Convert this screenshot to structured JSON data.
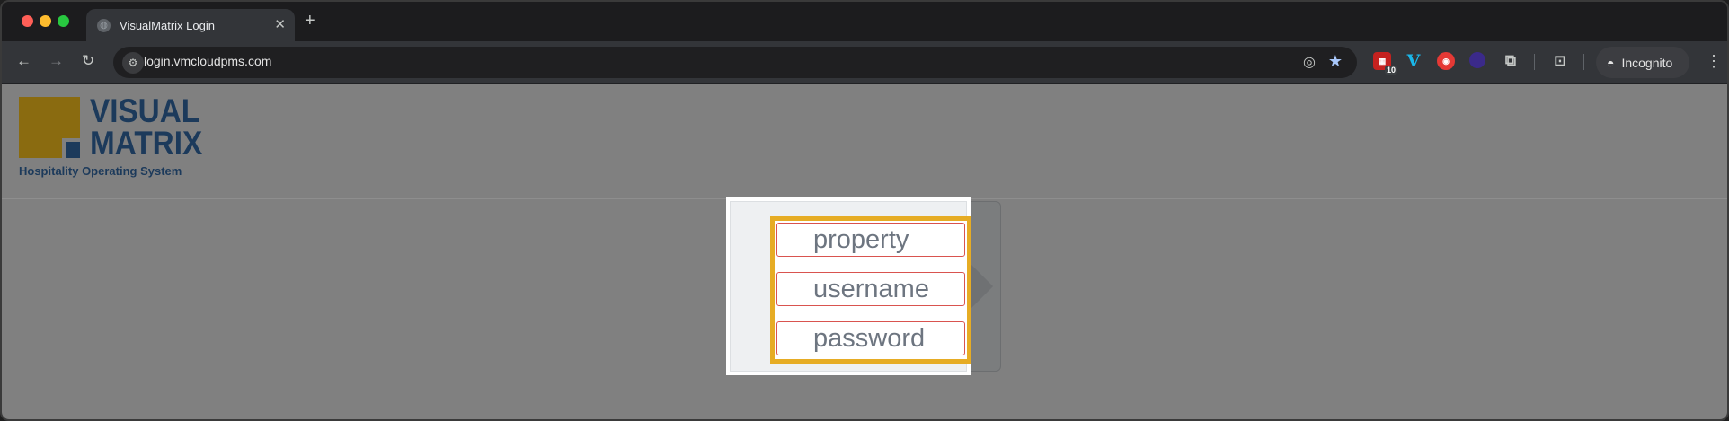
{
  "browser": {
    "tab": {
      "title": "VisualMatrix Login",
      "close_glyph": "✕",
      "newtab_glyph": "+"
    },
    "nav": {
      "back_glyph": "←",
      "forward_glyph": "→",
      "reload_glyph": "↻"
    },
    "omnibox": {
      "url": "login.vmcloudpms.com"
    },
    "extensions": {
      "calendar_badge": "10",
      "v_label": "V"
    },
    "incognito": {
      "label": "Incognito"
    },
    "menu_glyph": "⋮"
  },
  "page": {
    "logo": {
      "line1": "VISUAL",
      "line2": "MATRIX",
      "tagline": "Hospitality Operating System"
    },
    "login": {
      "property_placeholder": "property",
      "username_placeholder": "username",
      "password_placeholder": "password"
    }
  },
  "colors": {
    "brand_navy": "#1c3a5b",
    "brand_gold": "#8a6b10",
    "highlight": "#e6ac24",
    "field_border": "#d9534f"
  }
}
